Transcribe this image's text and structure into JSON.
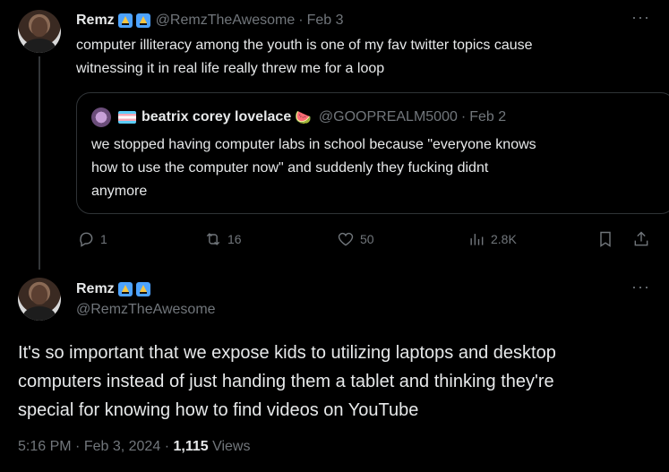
{
  "parent_tweet": {
    "name": "Remz",
    "handle": "@RemzTheAwesome",
    "date": "Feb 3",
    "text_line1": "computer illiteracy among the youth is one of my fav twitter topics cause",
    "text_line2": "witnessing it in real life really threw me for a loop",
    "quote": {
      "name": "beatrix corey lovelace",
      "emoji": "🍉",
      "handle": "@GOOPREALM5000",
      "date": "Feb 2",
      "line1": "we stopped having computer labs in school because \"everyone knows",
      "line2": "how to use the computer now\" and suddenly they fucking didnt",
      "line3": "anymore"
    },
    "actions": {
      "replies": "1",
      "retweets": "16",
      "likes": "50",
      "views": "2.8K"
    }
  },
  "main_tweet": {
    "name": "Remz",
    "handle": "@RemzTheAwesome",
    "line1": "It's so important that we expose kids to utilizing laptops and desktop",
    "line2": "computers instead of just handing them a tablet and thinking they're",
    "line3": "special for knowing how to find videos on YouTube",
    "time": "5:16 PM",
    "date": "Feb 3, 2024",
    "views_count": "1,115",
    "views_label": "Views"
  },
  "icons": {
    "more": "more-icon",
    "reply": "reply-icon",
    "retweet": "retweet-icon",
    "like": "heart-icon",
    "views": "views-icon",
    "bookmark": "bookmark-icon",
    "share": "share-icon"
  },
  "colors": {
    "background": "#000000",
    "text": "#e7e9ea",
    "muted": "#71767b",
    "border": "#2f3336"
  }
}
